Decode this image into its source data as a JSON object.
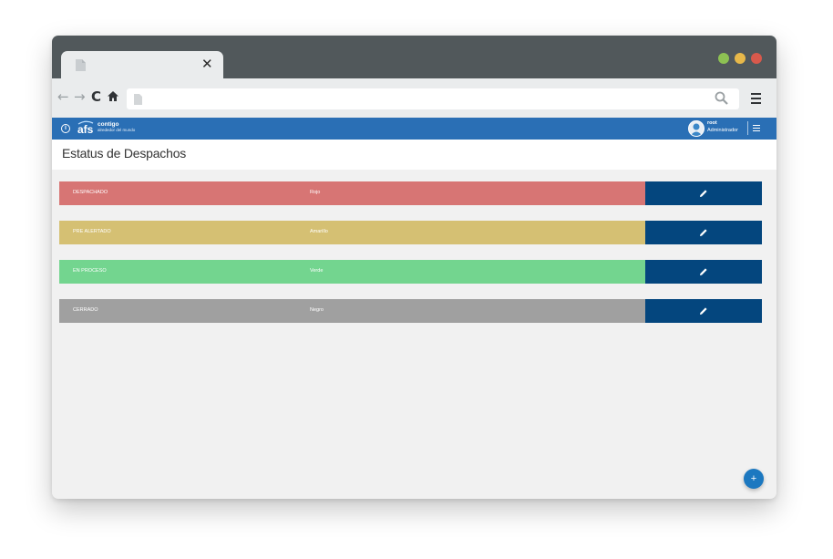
{
  "browser": {
    "tab_close": "✕",
    "nav": {
      "back": "←",
      "forward": "→",
      "reload": "C",
      "home": "⌂"
    }
  },
  "app": {
    "logo_mark": "afs",
    "logo_title": "contigo",
    "logo_subtitle": "alrededor del mundo",
    "user": {
      "name": "root",
      "role": "Administrador"
    }
  },
  "page": {
    "title": "Estatus de Despachos"
  },
  "statuses": [
    {
      "name": "DESPACHADO",
      "color_label": "Rojo",
      "color": "#d77574"
    },
    {
      "name": "PRE ALERTADO",
      "color_label": "Amarillo",
      "color": "#d5c073"
    },
    {
      "name": "EN PROCESO",
      "color_label": "Verde",
      "color": "#73d58f"
    },
    {
      "name": "CERRADO",
      "color_label": "Negro",
      "color": "#a0a0a0"
    }
  ],
  "fab": {
    "label": "+"
  },
  "colors": {
    "appbar": "#2a6fb5",
    "edit_button": "#04467e"
  }
}
